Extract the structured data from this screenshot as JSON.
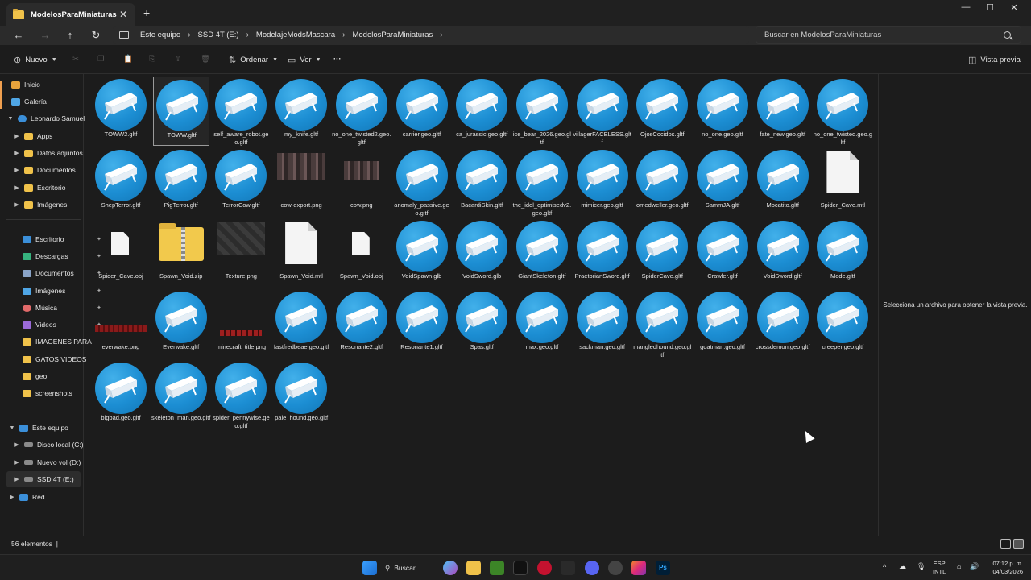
{
  "window": {
    "tab_title": "ModelosParaMiniaturas",
    "tab_close": "✕",
    "new_tab": "+",
    "minimize": "—",
    "maximize": "☐",
    "close": "✕"
  },
  "nav": {
    "back": "←",
    "forward": "→",
    "up": "↑",
    "refresh": "↻",
    "breadcrumbs": [
      "Este equipo",
      "SSD 4T (E:)",
      "ModelajeModsMascara",
      "ModelosParaMiniaturas"
    ],
    "chevron": "›",
    "search_placeholder": "Buscar en ModelosParaMiniaturas"
  },
  "toolbar": {
    "new_label": "Nuevo",
    "sort_label": "Ordenar",
    "view_label": "Ver",
    "more_label": "···",
    "preview_label": "Vista previa"
  },
  "sidebar": {
    "home": "Inicio",
    "gallery": "Galería",
    "user": "Leonardo Samuel",
    "user_items": [
      "Apps",
      "Datos adjuntos",
      "Documentos",
      "Escritorio",
      "Imágenes"
    ],
    "quick": [
      "Escritorio",
      "Descargas",
      "Documentos",
      "Imágenes",
      "Música",
      "Videos",
      "IMAGENES PARA",
      "GATOS VIDEOS",
      "geo",
      "screenshots"
    ],
    "this_pc": "Este equipo",
    "drives": [
      "Disco local (C:)",
      "Nuevo vol (D:)",
      "SSD 4T (E:)"
    ],
    "network": "Red"
  },
  "files": [
    {
      "name": "TOWW2.gltf",
      "type": "model"
    },
    {
      "name": "TOWW.gltf",
      "type": "model",
      "selected": true
    },
    {
      "name": "self_aware_robot.geo.gltf",
      "type": "model"
    },
    {
      "name": "my_knife.gltf",
      "type": "model"
    },
    {
      "name": "no_one_twisted2.geo.gltf",
      "type": "model"
    },
    {
      "name": "carrier.geo.gltf",
      "type": "model"
    },
    {
      "name": "ca_jurassic.geo.gltf",
      "type": "model"
    },
    {
      "name": "ice_bear_2026.geo.gltf",
      "type": "model"
    },
    {
      "name": "villagerFACELESS.gltf",
      "type": "model"
    },
    {
      "name": "OjosCocidos.gltf",
      "type": "model"
    },
    {
      "name": "no_one.geo.gltf",
      "type": "model"
    },
    {
      "name": "fate_new.geo.gltf",
      "type": "model"
    },
    {
      "name": "no_one_twisted.geo.gltf",
      "type": "model"
    },
    {
      "name": "ShepTerror.gltf",
      "type": "model"
    },
    {
      "name": "PigTerror.gltf",
      "type": "model"
    },
    {
      "name": "TerrorCow.gltf",
      "type": "model"
    },
    {
      "name": "cow-export.png",
      "type": "image-texture"
    },
    {
      "name": "cow.png",
      "type": "image-texture-small"
    },
    {
      "name": "anomaly_passive.geo.gltf",
      "type": "model"
    },
    {
      "name": "BacardiSkin.gltf",
      "type": "model"
    },
    {
      "name": "the_idol_optimisedv2.geo.gltf",
      "type": "model"
    },
    {
      "name": "mimicer.geo.gltf",
      "type": "model"
    },
    {
      "name": "omedweller.geo.gltf",
      "type": "model"
    },
    {
      "name": "SammJA.gltf",
      "type": "model"
    },
    {
      "name": "Mocatito.gltf",
      "type": "model"
    },
    {
      "name": "Spider_Cave.mtl",
      "type": "page"
    },
    {
      "name": "Spider_Cave.obj",
      "type": "page-small"
    },
    {
      "name": "Spawn_Void.zip",
      "type": "zip"
    },
    {
      "name": "Texture.png",
      "type": "image-dark"
    },
    {
      "name": "Spawn_Void.mtl",
      "type": "page"
    },
    {
      "name": "Spawn_Void.obj",
      "type": "page-small"
    },
    {
      "name": "VoidSpawn.glb",
      "type": "model"
    },
    {
      "name": "VoidSword.glb",
      "type": "model"
    },
    {
      "name": "GiantSkeleton.gltf",
      "type": "model"
    },
    {
      "name": "PraetorianSword.gltf",
      "type": "model"
    },
    {
      "name": "SpiderCave.gltf",
      "type": "model"
    },
    {
      "name": "Crawler.gltf",
      "type": "model"
    },
    {
      "name": "VoidSword.gltf",
      "type": "model"
    },
    {
      "name": "Mode.gltf",
      "type": "model"
    },
    {
      "name": "everwake.png",
      "type": "image-red-strip"
    },
    {
      "name": "Everwake.gltf",
      "type": "model"
    },
    {
      "name": "minecraft_title.png",
      "type": "image-red-text"
    },
    {
      "name": "fastfredbeae.geo.gltf",
      "type": "model"
    },
    {
      "name": "Resonante2.gltf",
      "type": "model"
    },
    {
      "name": "Resonante1.gltf",
      "type": "model"
    },
    {
      "name": "Spas.gltf",
      "type": "model"
    },
    {
      "name": "max.geo.gltf",
      "type": "model"
    },
    {
      "name": "sackman.geo.gltf",
      "type": "model"
    },
    {
      "name": "mangledhound.geo.gltf",
      "type": "model"
    },
    {
      "name": "goatman.geo.gltf",
      "type": "model"
    },
    {
      "name": "crossdemon.geo.gltf",
      "type": "model"
    },
    {
      "name": "creeper.geo.gltf",
      "type": "model"
    },
    {
      "name": "bigbad.geo.gltf",
      "type": "model"
    },
    {
      "name": "skeleton_man.geo.gltf",
      "type": "model"
    },
    {
      "name": "spider_pennywise.geo.gltf",
      "type": "model"
    },
    {
      "name": "pale_hound.geo.gltf",
      "type": "model"
    }
  ],
  "preview": {
    "message": "Selecciona un archivo para obtener la vista previa."
  },
  "status": {
    "count": "56 elementos",
    "separator": "|"
  },
  "taskbar": {
    "search_label": "Buscar",
    "lang_top": "ESP",
    "lang_bottom": "INTL",
    "time": "07:12 p. m.",
    "date": "04/03/2026",
    "ps_label": "Ps"
  },
  "colors": {
    "accent": "#1c8ed3",
    "background": "#1c1c1c",
    "folder": "#f0c24a"
  }
}
